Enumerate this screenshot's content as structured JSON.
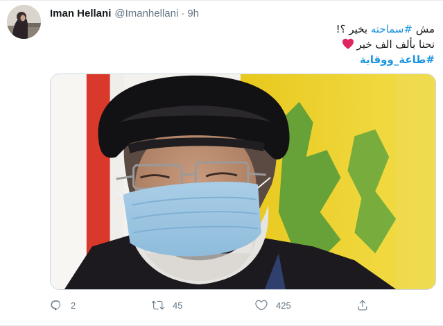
{
  "tweet": {
    "display_name": "Iman Hellani",
    "handle": "@Imanhellani",
    "separator": "·",
    "time": "9h",
    "text": {
      "line1_prefix": "مش ",
      "line1_hashtag": "#سماحته",
      "line1_suffix": " بخير ؟!",
      "line2": "نحنا بألف الف خير",
      "line2_emoji_icon": "red-heart",
      "line3_hashtag": "#طاعة_ووقاية"
    }
  },
  "actions": {
    "replies": "2",
    "retweets": "45",
    "likes": "425"
  },
  "icons": [
    "reply-icon",
    "retweet-icon",
    "like-icon",
    "share-icon"
  ],
  "colors": {
    "hashtag": "#1b95e0",
    "secondary_text": "#657786",
    "heart": "#e0245e",
    "border": "#e6ecf0"
  }
}
